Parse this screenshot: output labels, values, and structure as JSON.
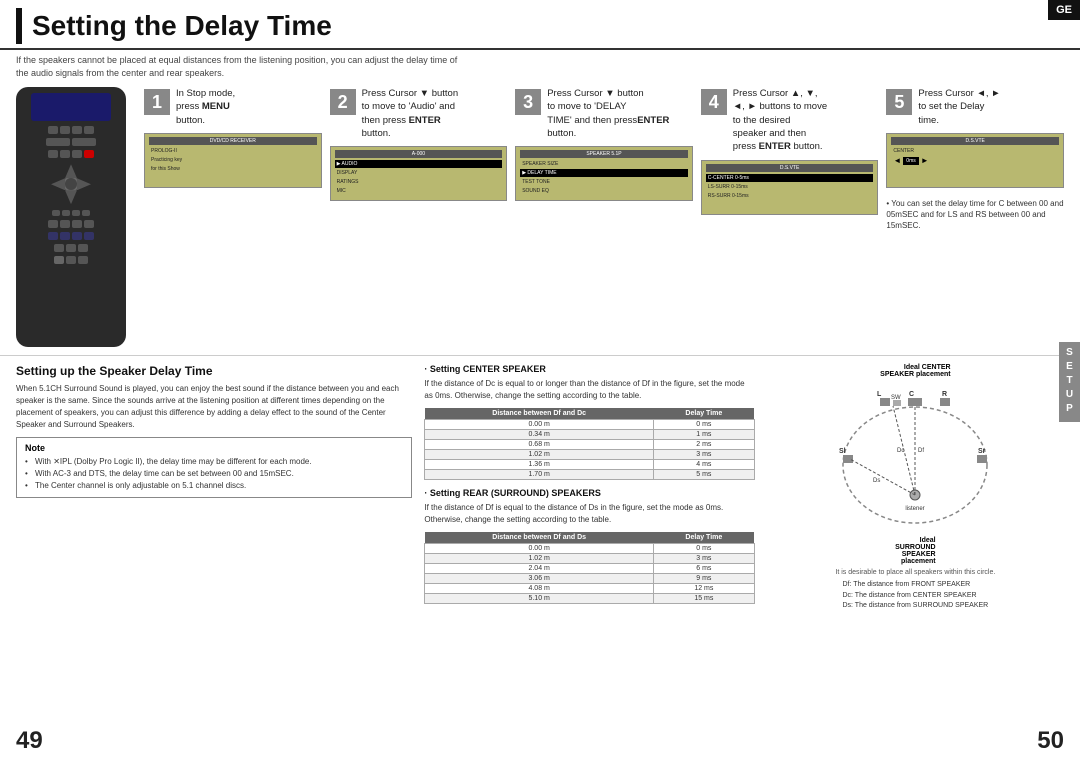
{
  "page": {
    "title": "Setting the Delay Time",
    "subtitle_line1": "If the speakers cannot be placed at equal distances from the listening position, you can adjust the delay time of",
    "subtitle_line2": "the audio signals from the center and rear speakers.",
    "ge_badge": "GE",
    "setup_badge": "SETUP",
    "page_left": "49",
    "page_right": "50"
  },
  "steps": [
    {
      "number": "1",
      "text_line1": "In Stop mode,",
      "text_line2": "press ",
      "text_bold": "MENU",
      "text_line3": "button."
    },
    {
      "number": "2",
      "text_line1": "Press Cursor ▼ button",
      "text_line2": "to move to 'Audio' and",
      "text_line3": "then press ",
      "text_bold": "ENTER",
      "text_line4": "button."
    },
    {
      "number": "3",
      "text_line1": "Press Cursor ▼ button",
      "text_line2": "to move to 'DELAY",
      "text_line3": "TIME' and then press",
      "text_bold": "ENTER",
      "text_line4": "button."
    },
    {
      "number": "4",
      "text_line1": "Press Cursor ▲, ▼,",
      "text_line2": "◄, ► buttons to move",
      "text_line3": "to the desired",
      "text_line4": "speaker and then",
      "text_bold": "ENTER",
      "text_line5": "press ",
      "text_line6": "button."
    },
    {
      "number": "5",
      "text_line1": "Press Cursor ◄, ►",
      "text_line2": "to set the Delay",
      "text_line3": "time.",
      "note": "• You can set the delay time for C between 00 and 05mSEC and for LS and RS between 00 and 15mSEC."
    }
  ],
  "bottom": {
    "section_title": "Setting up the Speaker Delay Time",
    "body_text1": "When 5.1CH Surround Sound is played, you can enjoy the best sound if the distance between you and each speaker is the same. Since the sounds arrive at the listening position at different times depending on the placement of speakers, you can adjust this difference by adding a delay effect to the sound of the Center Speaker and Surround Speakers.",
    "note_title": "Note",
    "note_items": [
      "With ✕IPL (Dolby Pro Logic II), the delay time may be different for each mode.",
      "With AC-3 and DTS, the delay time can be set between 00 and 15mSEC.",
      "The Center channel is only adjustable on 5.1 channel discs."
    ],
    "center_speaker_title": "· Setting CENTER SPEAKER",
    "center_speaker_text": "If the distance of Dc is equal to or longer than the distance of Df in the figure, set the mode as 0ms. Otherwise, change the setting according to the table.",
    "center_table_headers": [
      "Distance between Df and Dc",
      "Delay Time"
    ],
    "center_table_rows": [
      [
        "0.00 m",
        "0 ms"
      ],
      [
        "0.34 m",
        "1 ms"
      ],
      [
        "0.68 m",
        "2 ms"
      ],
      [
        "1.02 m",
        "3 ms"
      ],
      [
        "1.36 m",
        "4 ms"
      ],
      [
        "1.70 m",
        "5 ms"
      ]
    ],
    "rear_speaker_title": "· Setting REAR (SURROUND) SPEAKERS",
    "rear_speaker_text": "If the distance of Df is equal to the distance of Ds in the figure, set the mode as 0ms. Otherwise, change the setting according to the table.",
    "rear_table_headers": [
      "Distance between Df and Ds",
      "Delay Time"
    ],
    "rear_table_rows": [
      [
        "0.00 m",
        "0 ms"
      ],
      [
        "1.02 m",
        "3 ms"
      ],
      [
        "2.04 m",
        "6 ms"
      ],
      [
        "3.06 m",
        "9 ms"
      ],
      [
        "4.08 m",
        "12 ms"
      ],
      [
        "5.10 m",
        "15 ms"
      ]
    ],
    "diagram_title_center": "Ideal CENTER",
    "diagram_title_center2": "SPEAKER placement",
    "diagram_labels": {
      "L": "L",
      "C": "C",
      "SW": "SW",
      "R": "R",
      "Dc": "Dc",
      "Df": "Df",
      "Ds": "Ds",
      "Sl": "Sl",
      "Sr": "Sr",
      "listener": "listener"
    },
    "diagram_ideal_surround": "Ideal",
    "diagram_surround_label": "SURROUND",
    "diagram_speaker_label": "SPEAKER",
    "diagram_placement": "placement",
    "diagram_legend": [
      "Df: The distance from FRONT SPEAKER",
      "Dc: The distance from CENTER SPEAKER",
      "Ds: The distance from SURROUND SPEAKER"
    ],
    "diagram_desirable": "It is desirable to place all speakers within this circle."
  }
}
